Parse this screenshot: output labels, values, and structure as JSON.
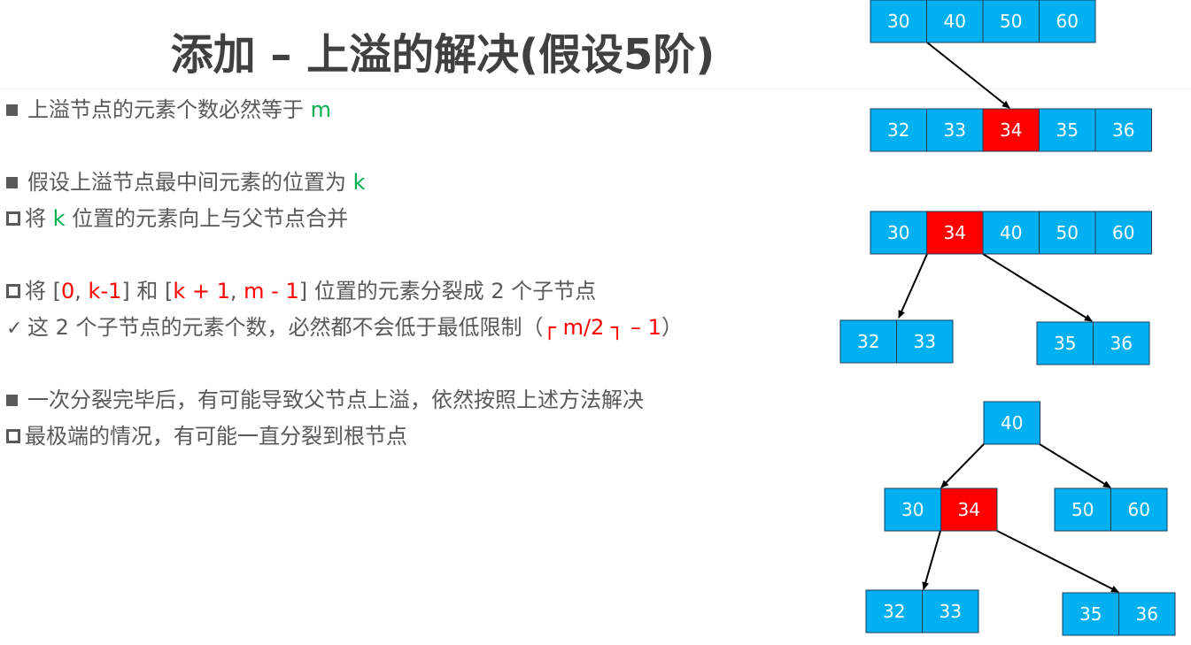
{
  "title": "添加 – 上溢的解决(假设5阶)",
  "bullets": [
    {
      "marker": "filled",
      "parts": [
        {
          "t": "上溢节点的元素个数必然等于 ",
          "c": ""
        },
        {
          "t": "m",
          "c": "g"
        }
      ]
    },
    {
      "marker": "filled",
      "parts": [
        {
          "t": "假设上溢节点最中间元素的位置为 ",
          "c": ""
        },
        {
          "t": "k",
          "c": "g"
        }
      ]
    },
    {
      "marker": "hollow",
      "parts": [
        {
          "t": "将 ",
          "c": ""
        },
        {
          "t": "k",
          "c": "g"
        },
        {
          "t": " 位置的元素向上与父节点合并",
          "c": ""
        }
      ]
    },
    {
      "marker": "hollow",
      "parts": [
        {
          "t": "将 [",
          "c": ""
        },
        {
          "t": "0",
          "c": "r"
        },
        {
          "t": ", ",
          "c": ""
        },
        {
          "t": "k-1",
          "c": "r"
        },
        {
          "t": "] 和 [",
          "c": ""
        },
        {
          "t": "k + 1",
          "c": "r"
        },
        {
          "t": ", ",
          "c": ""
        },
        {
          "t": "m - 1",
          "c": "r"
        },
        {
          "t": "] 位置的元素分裂成 2 个子节点",
          "c": ""
        }
      ]
    },
    {
      "marker": "check",
      "parts": [
        {
          "t": "这 2 个子节点的元素个数，必然都不会低于最低限制（",
          "c": ""
        },
        {
          "t": "┌ m/2 ┐ – 1",
          "c": "r"
        },
        {
          "t": "）",
          "c": ""
        }
      ]
    },
    {
      "marker": "filled",
      "parts": [
        {
          "t": "一次分裂完毕后，有可能导致父节点上溢，依然按照上述方法解决",
          "c": ""
        }
      ]
    },
    {
      "marker": "hollow",
      "parts": [
        {
          "t": "最极端的情况，有可能一直分裂到根节点",
          "c": ""
        }
      ]
    }
  ],
  "check_mark": "✓",
  "colors": {
    "node": "#00b0f0",
    "highlight": "#ff0000",
    "text": "#595959",
    "green": "#00b050"
  },
  "diagram": {
    "stage1": {
      "parent": [
        "30",
        "40",
        "50",
        "60"
      ],
      "child": [
        "32",
        "33",
        "34",
        "35",
        "36"
      ],
      "highlight_index": 2
    },
    "stage2": {
      "parent": [
        "30",
        "34",
        "40",
        "50",
        "60"
      ],
      "highlight_index": 1,
      "left": [
        "32",
        "33"
      ],
      "right": [
        "35",
        "36"
      ]
    },
    "stage3": {
      "root": [
        "40"
      ],
      "left": [
        "30",
        "34"
      ],
      "left_highlight_index": 1,
      "right": [
        "50",
        "60"
      ],
      "left_left": [
        "32",
        "33"
      ],
      "left_right": [
        "35",
        "36"
      ]
    }
  }
}
